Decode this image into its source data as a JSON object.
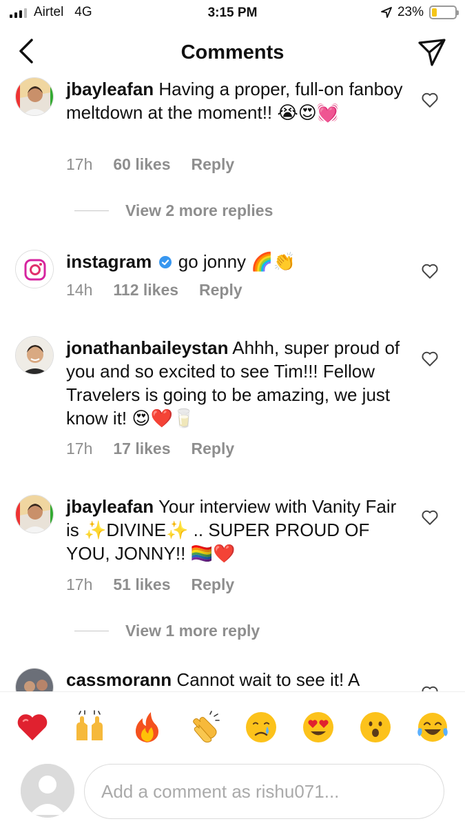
{
  "status_bar": {
    "carrier": "Airtel",
    "network": "4G",
    "time": "3:15 PM",
    "battery_percent": "23%",
    "battery_level": 0.23
  },
  "header": {
    "title": "Comments",
    "back_icon": "chevron-left-icon",
    "send_icon": "paper-plane-icon"
  },
  "comments": [
    {
      "username": "jbayleafan",
      "text": "Having a proper, full-on fanboy meltdown at the moment!! 😭😍💓",
      "time": "17h",
      "likes": "60 likes",
      "reply": "Reply"
    },
    {
      "username": "instagram",
      "verified": true,
      "text": "go jonny 🌈👏",
      "time": "14h",
      "likes": "112 likes",
      "reply": "Reply"
    },
    {
      "username": "jonathanbaileystan",
      "text": "Ahhh, super proud of you and so excited to see Tim!!! Fellow Travelers is going to be amazing, we just know it! 😍❤️🥛",
      "time": "17h",
      "likes": "17 likes",
      "reply": "Reply"
    },
    {
      "username": "jbayleafan",
      "text": "Your interview with Vanity Fair is ✨DIVINE✨ .. SUPER PROUD OF YOU, JONNY!! 🏳️‍🌈❤️",
      "time": "17h",
      "likes": "51 likes",
      "reply": "Reply"
    },
    {
      "username": "cassmorann",
      "text": "Cannot wait to see it! A"
    }
  ],
  "view_replies": [
    "View 2 more replies",
    "View 1 more reply"
  ],
  "emoji_bar": {
    "emojis": [
      "❤️",
      "🙌",
      "🔥",
      "👏",
      "😢",
      "😍",
      "😮",
      "😂"
    ]
  },
  "composer": {
    "placeholder": "Add a comment as rishu071..."
  },
  "colors": {
    "secondary_text": "#8e8e8e",
    "verified_blue": "#3897f0",
    "battery_fill": "#f5c518"
  }
}
